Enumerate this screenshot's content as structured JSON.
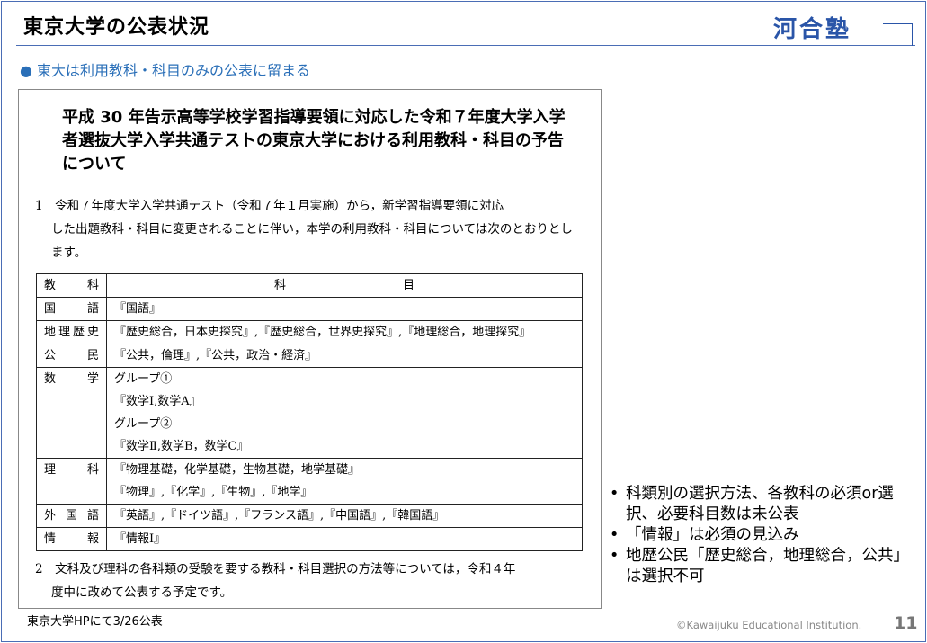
{
  "slide": {
    "title": "東京大学の公表状況",
    "subtitle": "● 東大は利用教科・科目のみの公表に留まる",
    "logo": "河合塾",
    "copyright": "©Kawaijuku Educational Institution.",
    "page": "11",
    "source": "東京大学HPにて3/26公表"
  },
  "doc": {
    "title": "平成 30 年告示高等学校学習指導要領に対応した令和７年度大学入学者選抜大学入学共通テストの東京大学における利用教科・科目の予告について",
    "para1_head": "1　令和７年度大学入学共通テスト（令和７年１月実施）から，新学習指導要領に対応",
    "para1_rest": "した出題教科・科目に変更されることに伴い，本学の利用教科・科目については次のとおりとします。",
    "para2_head": "2　文科及び理科の各科類の受験を要する教科・科目選択の方法等については，令和４年",
    "para2_rest": "度中に改めて公表する予定です。",
    "table": {
      "header": [
        "教　科",
        "科　　　　　　　　　　目"
      ],
      "rows": [
        {
          "k": "国語",
          "v": [
            "『国語』"
          ]
        },
        {
          "k": "地理歴史",
          "v": [
            "『歴史総合，日本史探究』,『歴史総合，世界史探究』,『地理総合，地理探究』"
          ]
        },
        {
          "k": "公民",
          "v": [
            "『公共，倫理』,『公共，政治・経済』"
          ]
        },
        {
          "k": "数学",
          "v": [
            "グループ①",
            "『数学Ⅰ,数学A』",
            "グループ②",
            "『数学Ⅱ,数学B，数学C』"
          ]
        },
        {
          "k": "理科",
          "v": [
            "『物理基礎，化学基礎，生物基礎，地学基礎』",
            "『物理』,『化学』,『生物』,『地学』"
          ]
        },
        {
          "k": "外国語",
          "v": [
            "『英語』,『ドイツ語』,『フランス語』,『中国語』,『韓国語』"
          ]
        },
        {
          "k": "情報",
          "v": [
            "『情報Ⅰ』"
          ]
        }
      ]
    }
  },
  "notes": [
    "科類別の選択方法、各教科の必須or選択、必要科目数は未公表",
    "「情報」は必須の見込み",
    "地歴公民「歴史総合，地理総合，公共」は選択不可"
  ]
}
